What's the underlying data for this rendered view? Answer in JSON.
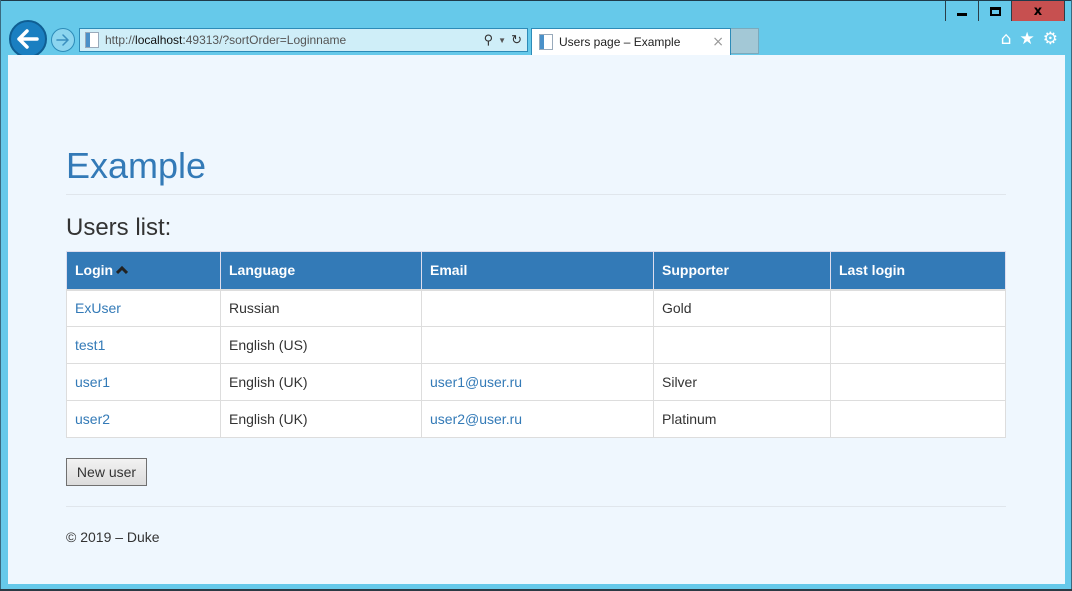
{
  "window": {
    "minimize_label": "minimize",
    "maximize_label": "maximize",
    "close_glyph": "x"
  },
  "browser": {
    "url_prefix": "http://",
    "url_host": "localhost",
    "url_rest": ":49313/?sortOrder=Loginname",
    "tab_title": "Users page – Example",
    "tab_close_glyph": "×",
    "icons": {
      "back": "arrow-left-icon",
      "forward": "arrow-right-icon",
      "search": "⚲",
      "dropdown": "▼",
      "refresh": "↻",
      "home": "⌂",
      "favorites": "★",
      "settings": "⚙"
    }
  },
  "page": {
    "site_title": "Example",
    "section_title": "Users list:",
    "table": {
      "columns": [
        "Login",
        "Language",
        "Email",
        "Supporter",
        "Last login"
      ],
      "sorted_column": "Login",
      "sort_direction": "ascending",
      "rows": [
        {
          "login": "ExUser",
          "language": "Russian",
          "email": "",
          "supporter": "Gold",
          "last_login": ""
        },
        {
          "login": "test1",
          "language": "English (US)",
          "email": "",
          "supporter": "",
          "last_login": ""
        },
        {
          "login": "user1",
          "language": "English (UK)",
          "email": "user1@user.ru",
          "supporter": "Silver",
          "last_login": ""
        },
        {
          "login": "user2",
          "language": "English (UK)",
          "email": "user2@user.ru",
          "supporter": "Platinum",
          "last_login": ""
        }
      ]
    },
    "new_user_button": "New user",
    "footer": "© 2019 – Duke"
  },
  "colors": {
    "brand": "#337ab7",
    "chrome": "#66c9ea",
    "close_button": "#c75050",
    "page_bg": "#eff7fe"
  }
}
